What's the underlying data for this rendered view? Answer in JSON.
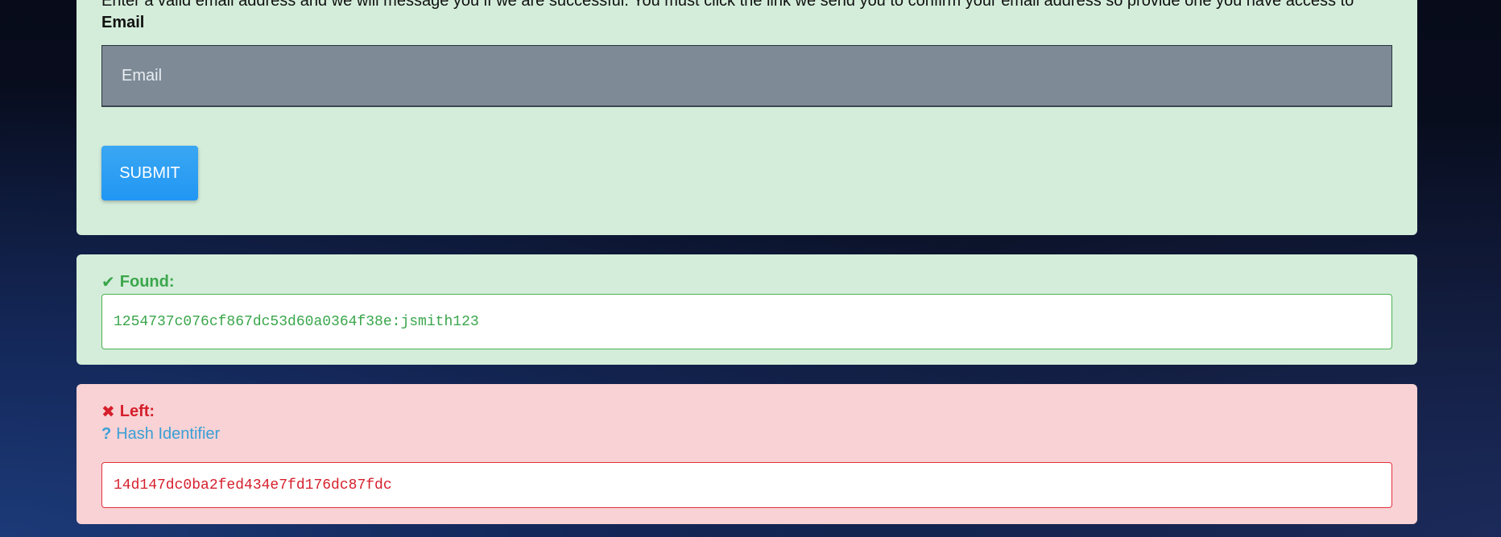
{
  "form": {
    "intro_text": "Enter a valid email address and we will message you if we are successful. You must click the link we send you to confirm your email address so provide one you have access to",
    "email_label": "Email",
    "email_placeholder": "Email",
    "email_value": "",
    "submit_label": "SUBMIT"
  },
  "found": {
    "icon": "check-icon",
    "icon_glyph": "✔",
    "heading": "Found:",
    "value": "1254737c076cf867dc53d60a0364f38e:jsmith123"
  },
  "left": {
    "icon": "x-icon",
    "icon_glyph": "✖",
    "heading": "Left:",
    "hash_identifier_icon_glyph": "?",
    "hash_identifier_label": "Hash Identifier",
    "value": "14d147dc0ba2fed434e7fd176dc87fdc"
  },
  "colors": {
    "success_bg": "#d4edda",
    "success_text": "#3aa64b",
    "danger_bg": "#f8d2d4",
    "danger_text": "#d61f2c",
    "info_text": "#3a9fd6",
    "button_blue": "#2196f3"
  }
}
